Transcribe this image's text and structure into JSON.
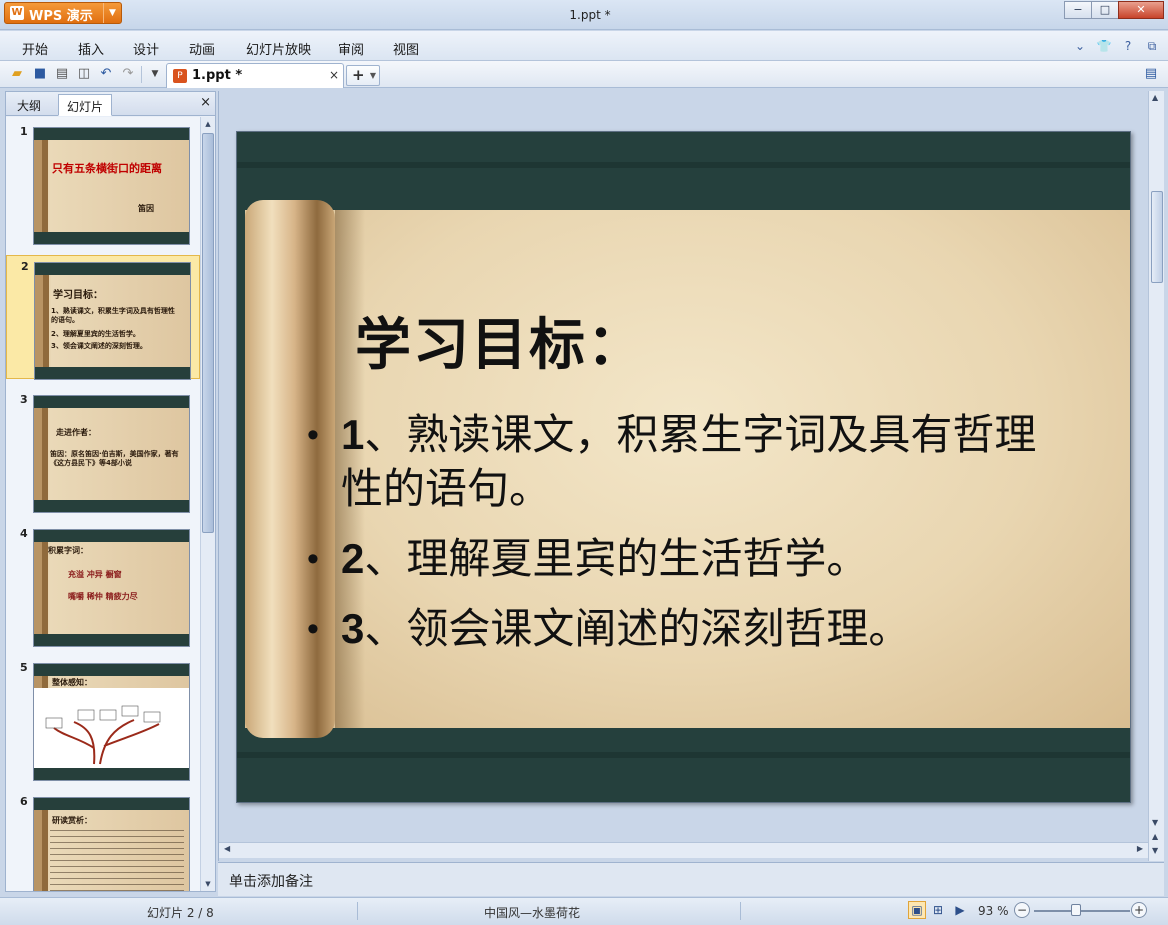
{
  "app": {
    "button_label": "WPS 演示",
    "window_title": "1.ppt *"
  },
  "window_controls": {
    "minimize": "−",
    "maximize": "□",
    "close": "✕"
  },
  "menu": [
    "开始",
    "插入",
    "设计",
    "动画",
    "幻灯片放映",
    "审阅",
    "视图"
  ],
  "doc_tab": {
    "label": "1.ppt *",
    "close": "×"
  },
  "left_panel": {
    "tabs": [
      "大纲",
      "幻灯片"
    ],
    "active_tab": "幻灯片",
    "close": "×",
    "slides": [
      {
        "num": "1",
        "title": "只有五条横街口的距离",
        "lines": [
          "笛因"
        ]
      },
      {
        "num": "2",
        "title": "学习目标：",
        "lines": [
          "1、熟读课文，积累生字词及具有哲理性的语句。",
          "2、理解夏里宾的生活哲学。",
          "3、领会课文阐述的深刻哲理。"
        ]
      },
      {
        "num": "3",
        "title": "走进作者：",
        "lines": [
          "笛因：原名笛因·伯吉斯，美国作家，著有《这方县民下》等4部小说"
        ]
      },
      {
        "num": "4",
        "title": "积累字词：",
        "lines": [
          "充溢  冲异  橱窗",
          "嘴嚼  稀仲  精疲力尽"
        ]
      },
      {
        "num": "5",
        "title": "整体感知：",
        "lines": []
      },
      {
        "num": "6",
        "title": "研读赏析：",
        "lines": []
      }
    ]
  },
  "slide": {
    "title": "学习目标：",
    "bullets": [
      {
        "num": "1",
        "text": "、熟读课文，积累生字词及具有哲理性的语句。"
      },
      {
        "num": "2",
        "text": "、理解夏里宾的生活哲学。"
      },
      {
        "num": "3",
        "text": "、领会课文阐述的深刻哲理。"
      }
    ]
  },
  "notes_placeholder": "单击添加备注",
  "status": {
    "slide_counter": "幻灯片 2 / 8",
    "theme": "中国风—水墨荷花",
    "zoom": "93 %",
    "zoom_level_percent": 93
  }
}
